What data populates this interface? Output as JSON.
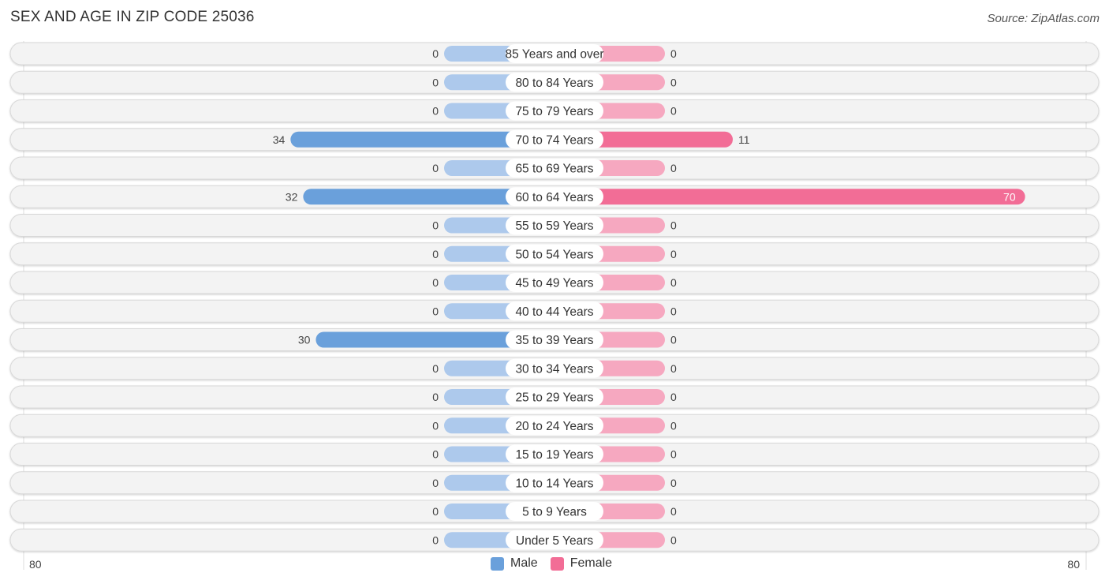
{
  "header": {
    "title": "SEX AND AGE IN ZIP CODE 25036",
    "source": "Source: ZipAtlas.com"
  },
  "legend": {
    "male_label": "Male",
    "female_label": "Female"
  },
  "axis": {
    "left_label": "80",
    "right_label": "80"
  },
  "colors": {
    "male": "#6aa0db",
    "male_light": "#adc9ec",
    "female": "#f26d96",
    "female_light": "#f6a8c0",
    "row_bg": "#f3f3f3"
  },
  "chart_data": {
    "type": "bar",
    "orientation": "horizontal-diverging",
    "title": "SEX AND AGE IN ZIP CODE 25036",
    "xlim": [
      -80,
      80
    ],
    "categories": [
      "85 Years and over",
      "80 to 84 Years",
      "75 to 79 Years",
      "70 to 74 Years",
      "65 to 69 Years",
      "60 to 64 Years",
      "55 to 59 Years",
      "50 to 54 Years",
      "45 to 49 Years",
      "40 to 44 Years",
      "35 to 39 Years",
      "30 to 34 Years",
      "25 to 29 Years",
      "20 to 24 Years",
      "15 to 19 Years",
      "10 to 14 Years",
      "5 to 9 Years",
      "Under 5 Years"
    ],
    "series": [
      {
        "name": "Male",
        "values": [
          0,
          0,
          0,
          34,
          0,
          32,
          0,
          0,
          0,
          0,
          30,
          0,
          0,
          0,
          0,
          0,
          0,
          0
        ]
      },
      {
        "name": "Female",
        "values": [
          0,
          0,
          0,
          11,
          0,
          70,
          0,
          0,
          0,
          0,
          0,
          0,
          0,
          0,
          0,
          0,
          0,
          0
        ]
      }
    ],
    "legend": "bottom-center"
  }
}
